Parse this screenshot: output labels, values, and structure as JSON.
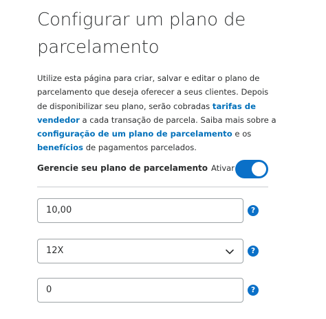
{
  "page": {
    "title": "Configurar um plano de parcelamento"
  },
  "description": {
    "part1": "Utilize esta página para criar, salvar e editar o plano de parcelamento que deseja oferecer a seus clientes. Depois de disponibilizar seu plano, serão cobradas ",
    "link_fees": "tarifas de vendedor",
    "part2": " a cada transação de parcela. Saiba mais sobre a ",
    "link_config": "configuração de um plano de parcelamento",
    "part3": " e os ",
    "link_benefits": "benefícios",
    "part4": " de pagamentos parcelados."
  },
  "manage": {
    "label": "Gerencie seu plano de parcelamento",
    "toggle_label": "Ativar",
    "toggle_on": true
  },
  "fields": {
    "amount_value": "10,00",
    "installments_value": "12X",
    "third_value": "0",
    "help_glyph": "?"
  },
  "colors": {
    "accent": "#0070ba",
    "toggle": "#0a70c8"
  },
  "icons": {
    "help": "question-icon",
    "select": "chevron-down-icon"
  }
}
